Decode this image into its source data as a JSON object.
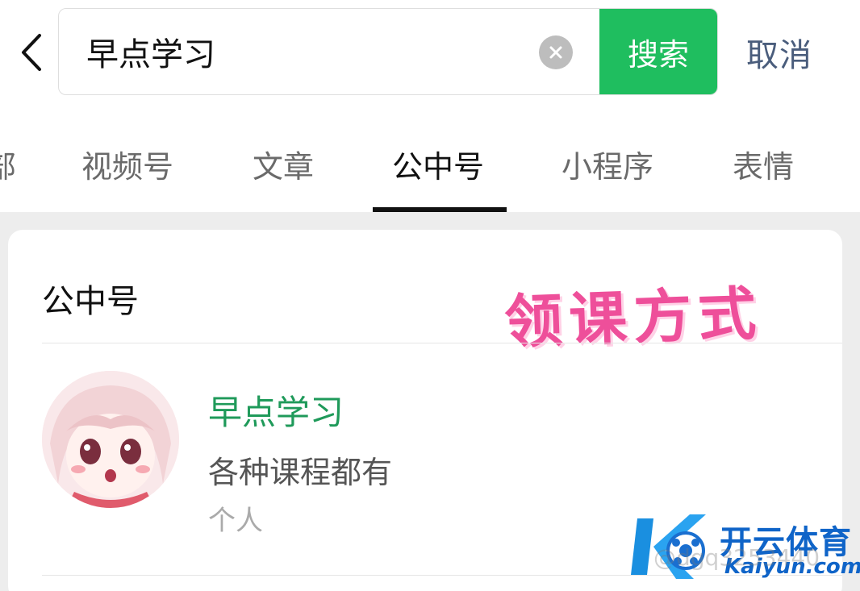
{
  "search": {
    "value": "早点学习",
    "button_label": "搜索",
    "cancel_label": "取消"
  },
  "tabs": [
    {
      "label": "部",
      "active": false
    },
    {
      "label": "视频号",
      "active": false
    },
    {
      "label": "文章",
      "active": false
    },
    {
      "label": "公中号",
      "active": true
    },
    {
      "label": "小程序",
      "active": false
    },
    {
      "label": "表情",
      "active": false
    }
  ],
  "section": {
    "title": "公中号",
    "promo_text": "领课方式"
  },
  "result": {
    "name": "早点学习",
    "description": "各种课程都有",
    "type": "个人"
  },
  "watermark": {
    "brand": "开云体育",
    "url": "Kaiyun.com",
    "handle": "@dgq3253440"
  },
  "colors": {
    "accent_green": "#1fbe5f",
    "name_green": "#1f9a5a",
    "cancel_blue": "#4a5d7c",
    "promo_pink": "#ee4f9a"
  },
  "icons": {
    "back": "chevron-left-icon",
    "clear": "close-circle-icon"
  }
}
